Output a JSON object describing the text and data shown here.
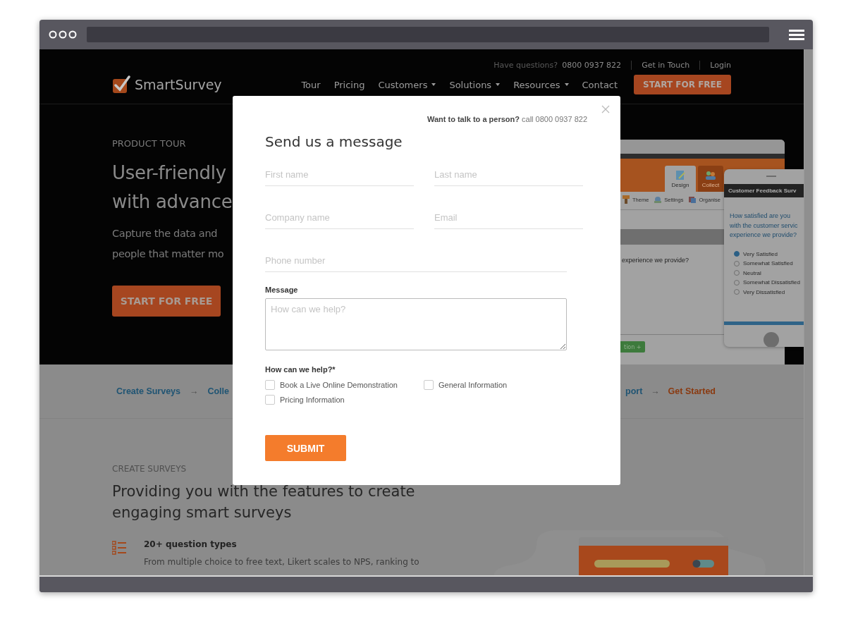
{
  "header": {
    "question_label": "Have questions?",
    "phone": "0800 0937 822",
    "links": [
      "Get in Touch",
      "Login"
    ],
    "logo": "SmartSurvey",
    "nav": [
      {
        "label": "Tour",
        "has_menu": false
      },
      {
        "label": "Pricing",
        "has_menu": false
      },
      {
        "label": "Customers",
        "has_menu": true
      },
      {
        "label": "Solutions",
        "has_menu": true
      },
      {
        "label": "Resources",
        "has_menu": true
      },
      {
        "label": "Contact",
        "has_menu": false
      }
    ],
    "cta": "START FOR FREE"
  },
  "hero": {
    "eyebrow": "PRODUCT TOUR",
    "heading_lines": [
      "User-friendly",
      "with advance"
    ],
    "body_lines": [
      "Capture the data and",
      "people that matter mo"
    ],
    "cta": "START FOR FREE"
  },
  "mockup": {
    "tabs": [
      {
        "label": "Design",
        "selected": true
      },
      {
        "label": "Collect",
        "selected": false
      }
    ],
    "toolbar": [
      "Theme",
      "Settings",
      "Organise"
    ],
    "question": "experience we provide?",
    "add_button": "tion +",
    "phone": {
      "title": "Customer Feedback Surv",
      "question": "How satisfied are you with the customer servic experience we provide?",
      "options": [
        {
          "label": "Very Satisfied",
          "selected": true
        },
        {
          "label": "Somewhat Satisfied",
          "selected": false
        },
        {
          "label": "Neutral",
          "selected": false
        },
        {
          "label": "Somewhat Dissatisfied",
          "selected": false
        },
        {
          "label": "Very Dissatisfied",
          "selected": false
        }
      ]
    }
  },
  "steps": {
    "left": [
      {
        "label": "Create Surveys",
        "kind": "link"
      },
      {
        "label": "→",
        "kind": "arrow"
      },
      {
        "label": "Colle",
        "kind": "link"
      }
    ],
    "right": [
      {
        "label": "port",
        "kind": "link"
      },
      {
        "label": "→",
        "kind": "arrow"
      },
      {
        "label": "Get Started",
        "kind": "highlight"
      }
    ]
  },
  "features": {
    "eyebrow": "CREATE SURVEYS",
    "heading_lines": [
      "Providing you with the features to create",
      "engaging smart surveys"
    ],
    "items": [
      {
        "title": "20+ question types",
        "text": "From multiple choice to free text, Likert scales to NPS, ranking to"
      }
    ]
  },
  "modal": {
    "contact_note": "**Want to talk to a person?** call 0800 0937 822",
    "title": "Send us a message",
    "field_rows": [
      [
        {
          "placeholder": "First name"
        },
        {
          "placeholder": "Last name"
        }
      ],
      [
        {
          "placeholder": "Company name"
        },
        {
          "placeholder": "Email"
        }
      ],
      [
        {
          "placeholder": "Phone number"
        }
      ]
    ],
    "message_label": "Message",
    "message_placeholder": "How can we help?",
    "help_label": "How can we help?*",
    "options": [
      {
        "label": "Book a Live Online Demonstration",
        "checked": false
      },
      {
        "label": "General Information",
        "checked": false
      },
      {
        "label": "Pricing Information",
        "checked": false
      }
    ],
    "submit": "SUBMIT"
  }
}
